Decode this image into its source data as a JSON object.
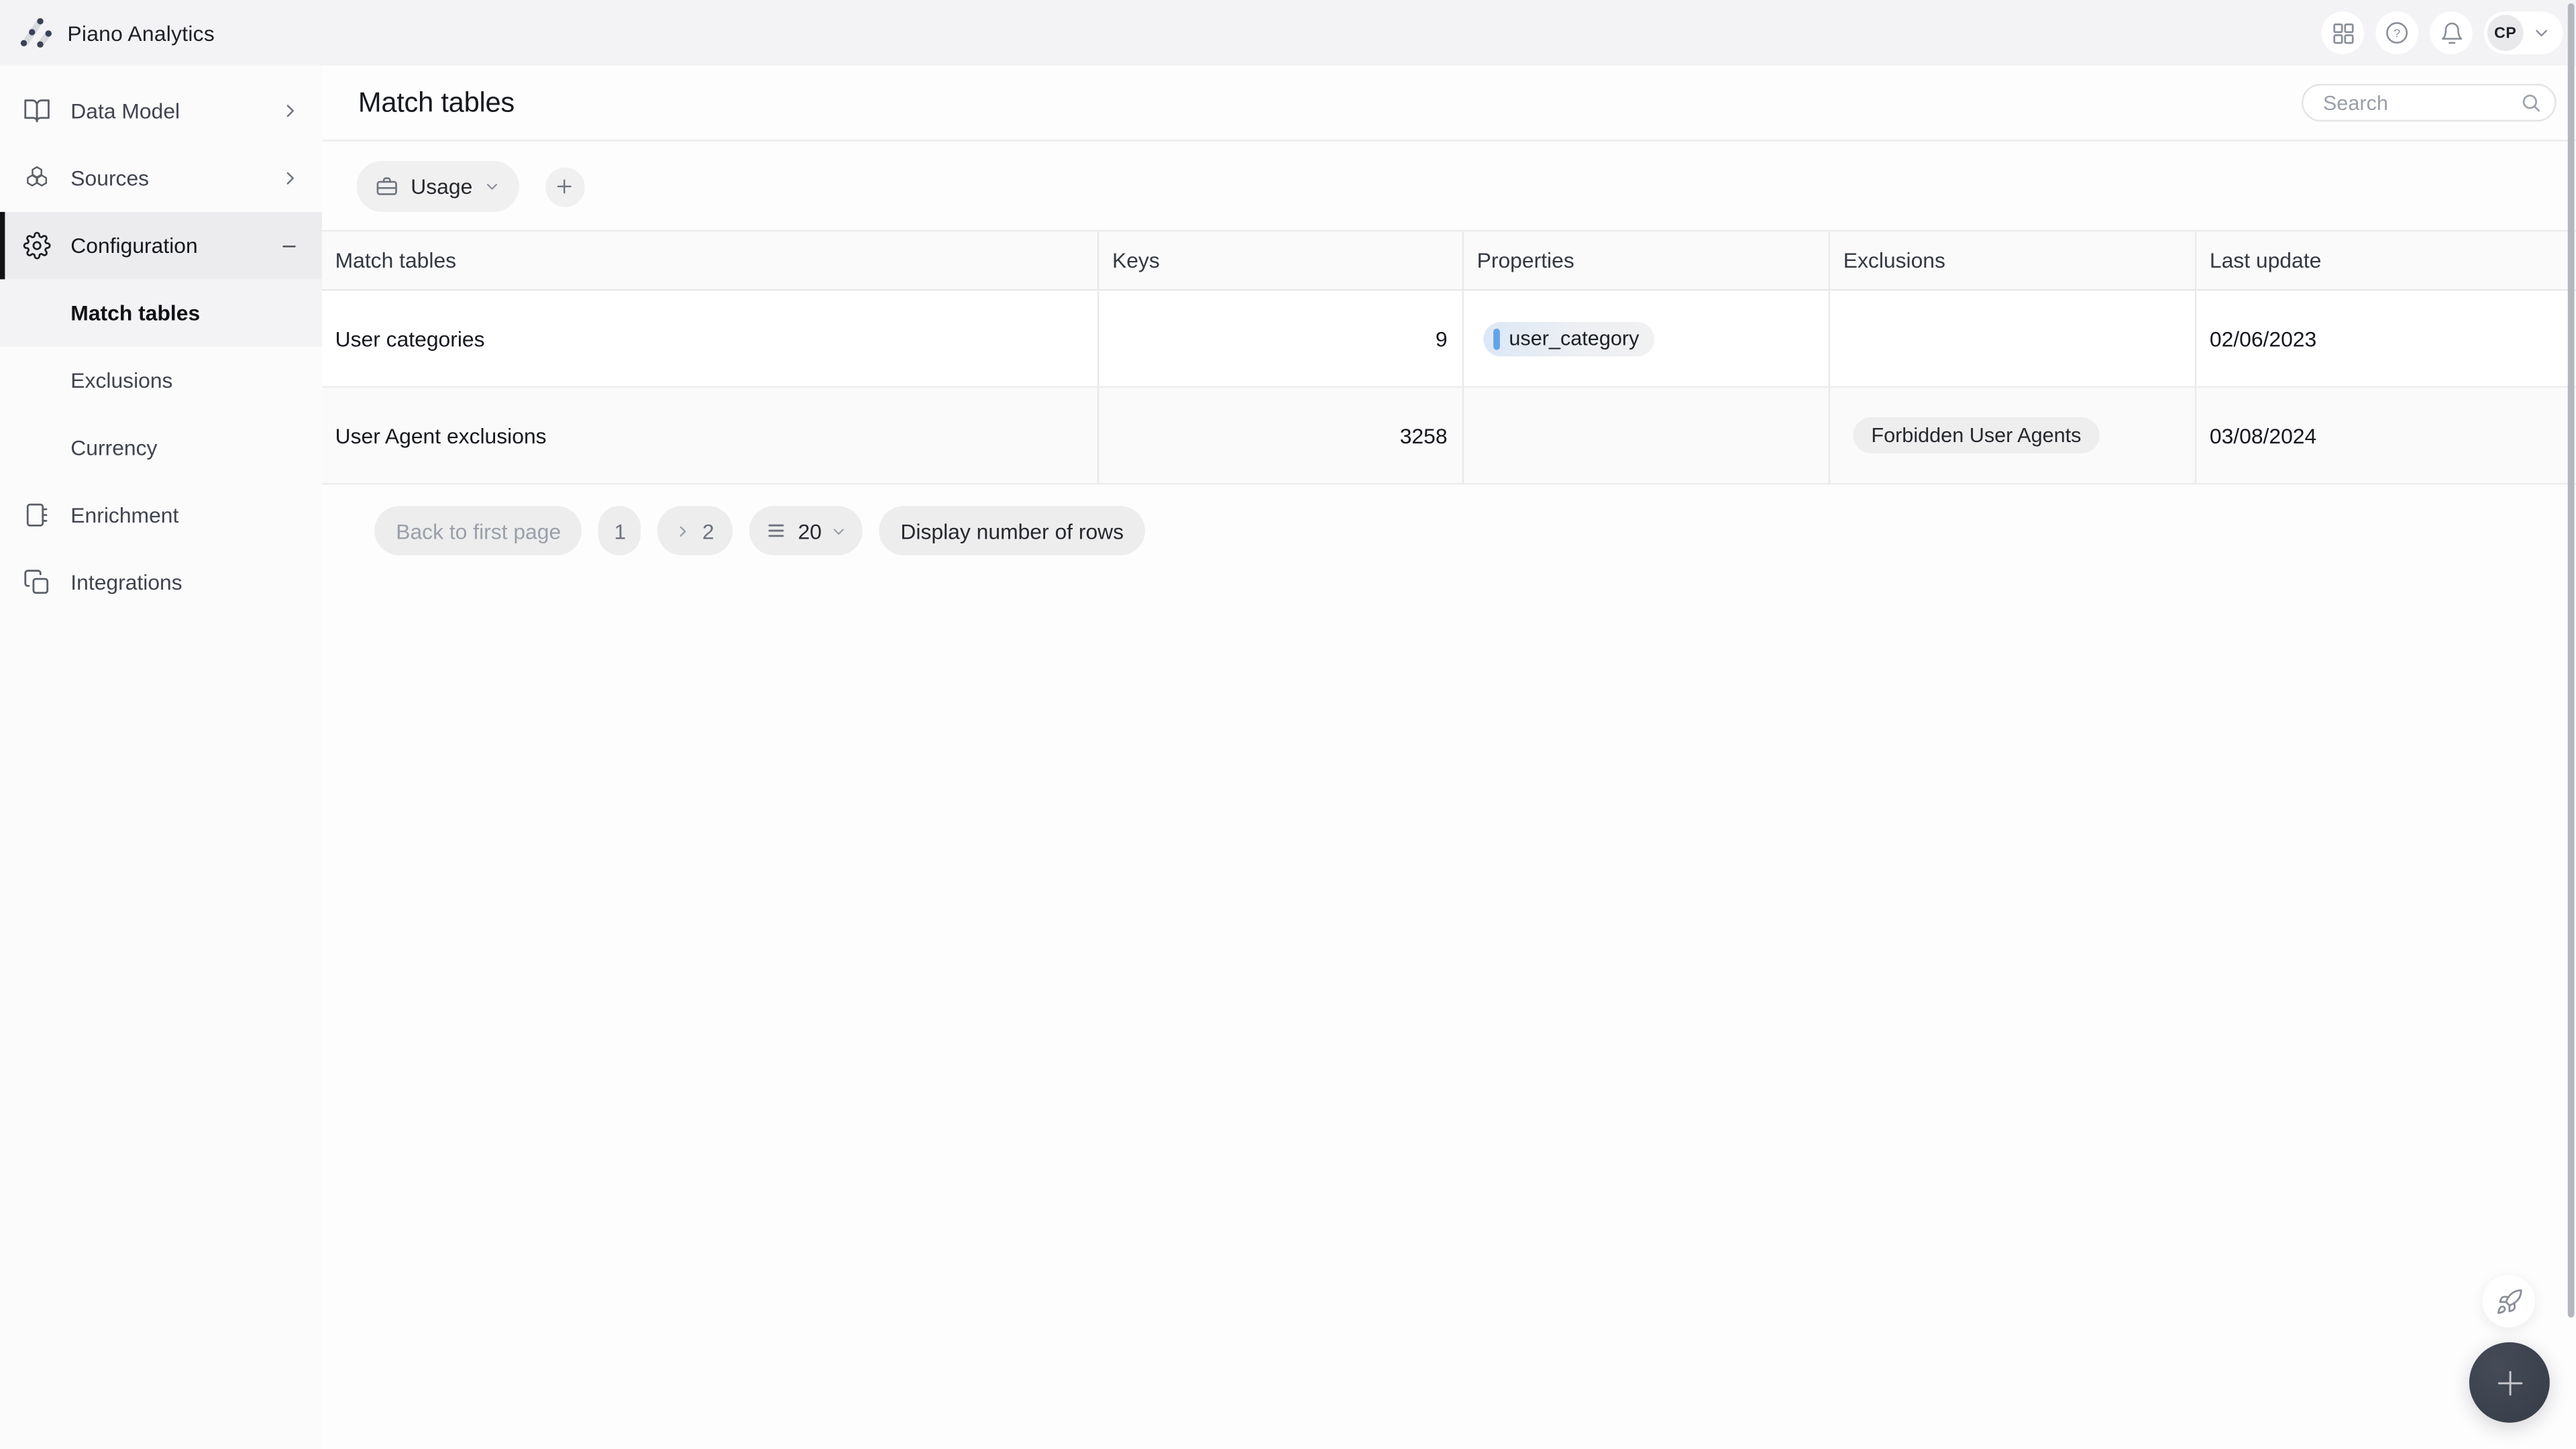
{
  "brand": {
    "name": "Piano Analytics"
  },
  "topbar": {
    "account_initials": "CP"
  },
  "sidebar": {
    "items": [
      {
        "label": "Data Model"
      },
      {
        "label": "Sources"
      },
      {
        "label": "Configuration"
      },
      {
        "label": "Match tables"
      },
      {
        "label": "Exclusions"
      },
      {
        "label": "Currency"
      },
      {
        "label": "Enrichment"
      },
      {
        "label": "Integrations"
      }
    ]
  },
  "page": {
    "title": "Match tables"
  },
  "search": {
    "placeholder": "Search"
  },
  "toolbar": {
    "usage_label": "Usage"
  },
  "table": {
    "columns": [
      "Match tables",
      "Keys",
      "Properties",
      "Exclusions",
      "Last update"
    ],
    "rows": [
      {
        "name": "User categories",
        "keys": "9",
        "property_badge": "user_category",
        "exclusion_badge": "",
        "last_update": "02/06/2023"
      },
      {
        "name": "User Agent exclusions",
        "keys": "3258",
        "property_badge": "",
        "exclusion_badge": "Forbidden User Agents",
        "last_update": "03/08/2024"
      }
    ]
  },
  "pagination": {
    "back_label": "Back to first page",
    "page_1": "1",
    "page_2": "2",
    "rows_per_page": "20",
    "display_rows_label": "Display number of rows"
  },
  "icons": {
    "logo": "piano-analytics-logo",
    "apps": "grid-icon",
    "help": "question-circle-icon",
    "notifications": "bell-icon",
    "data_model": "book-open-icon",
    "sources": "hexagons-icon",
    "configuration": "gear-icon",
    "enrichment": "journal-icon",
    "integrations": "copy-squares-icon",
    "usage": "briefcase-icon",
    "rows": "list-icon",
    "assistant": "rocket-icon",
    "create": "plus-icon"
  },
  "colors": {
    "accent_blue": "#64a3e8",
    "fab_background": "#3e4450",
    "topbar_background": "#f3f3f5",
    "active_item_background": "#ececee"
  }
}
